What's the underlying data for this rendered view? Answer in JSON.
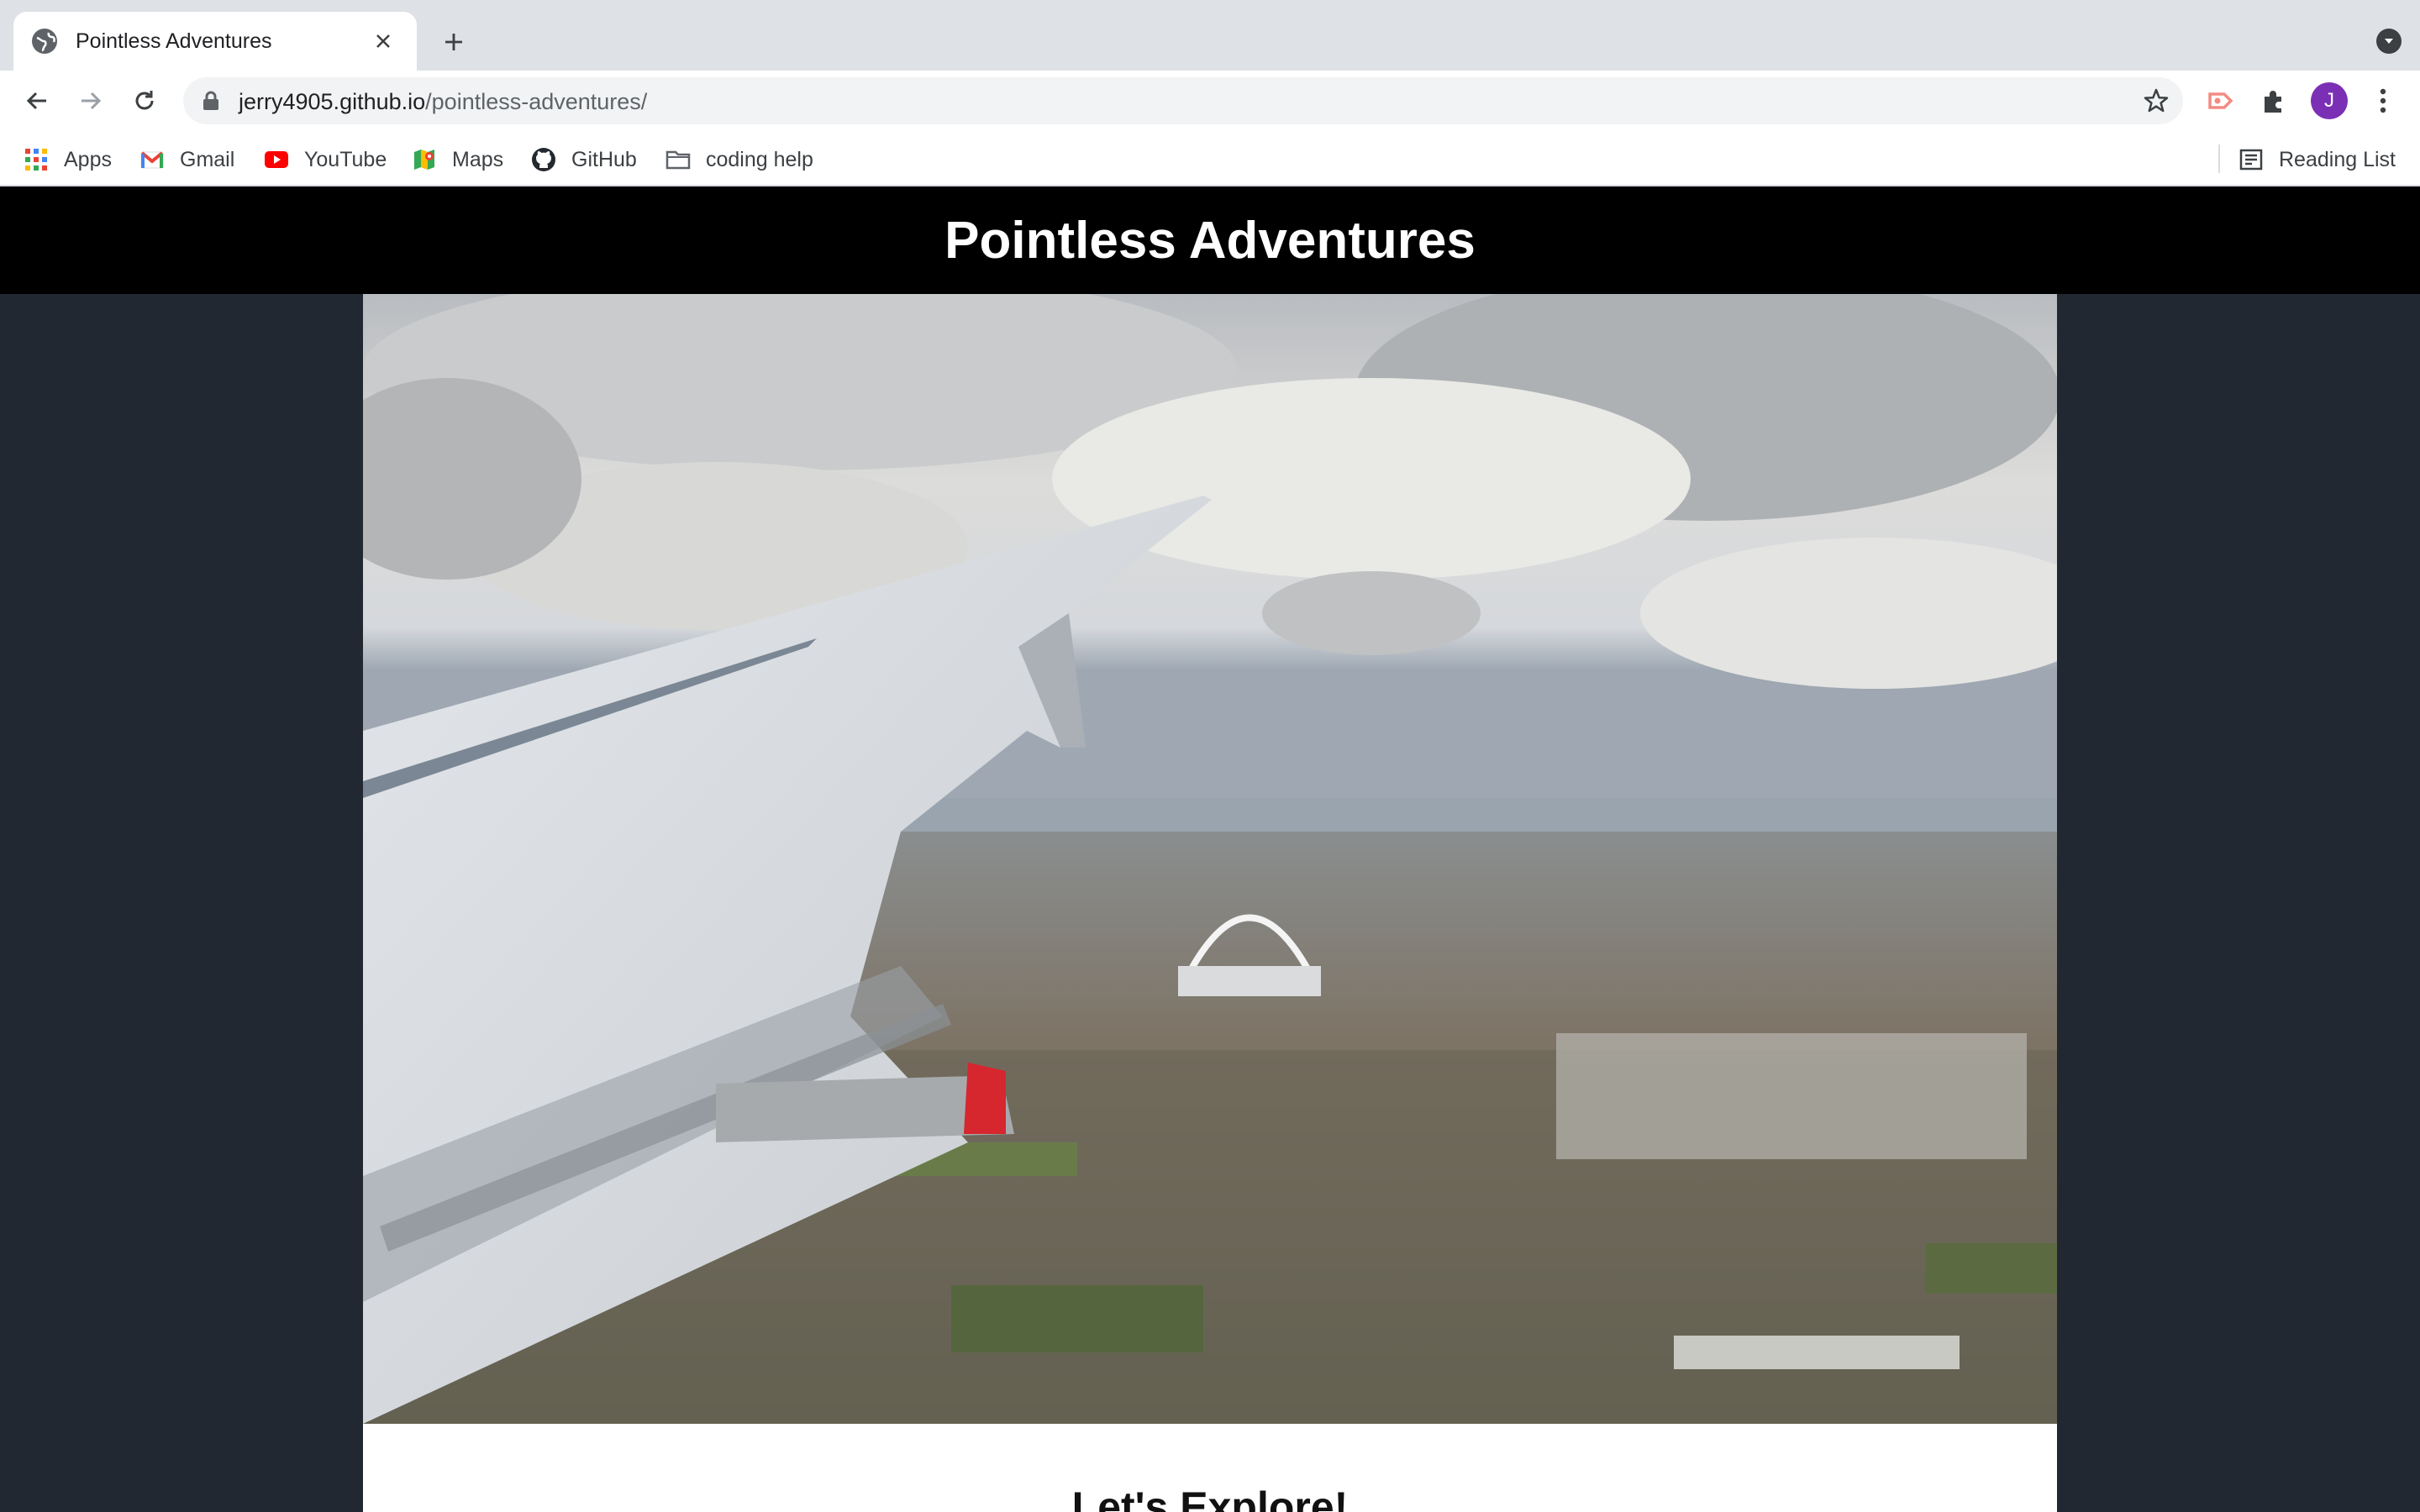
{
  "browser": {
    "tab": {
      "title": "Pointless Adventures",
      "favicon": "globe-icon"
    },
    "address_bar": {
      "domain": "jerry4905.github.io",
      "path": "/pointless-adventures/"
    },
    "profile_initial": "J",
    "bookmarks": [
      {
        "label": "Apps",
        "icon": "apps-grid-icon"
      },
      {
        "label": "Gmail",
        "icon": "gmail-icon"
      },
      {
        "label": "YouTube",
        "icon": "youtube-icon"
      },
      {
        "label": "Maps",
        "icon": "maps-icon"
      },
      {
        "label": "GitHub",
        "icon": "github-icon"
      },
      {
        "label": "coding help",
        "icon": "folder-icon"
      }
    ],
    "reading_list": "Reading List"
  },
  "page": {
    "site_title": "Pointless Adventures",
    "hero_image": "airplane-wing-over-city-photo",
    "section_heading": "Let's Explore!"
  }
}
